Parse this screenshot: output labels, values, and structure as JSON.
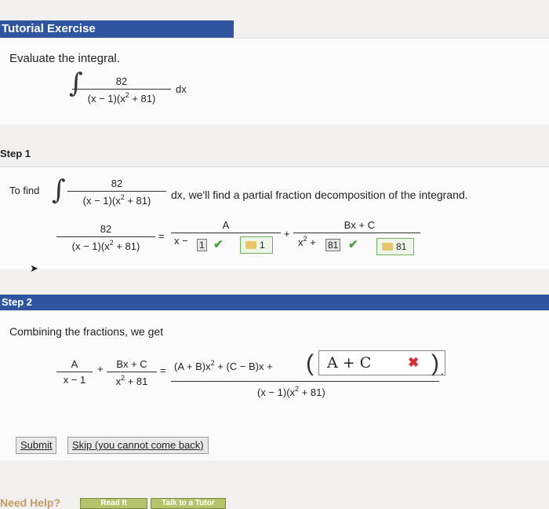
{
  "header": {
    "title": "Tutorial Exercise"
  },
  "prompt": "Evaluate the integral.",
  "integral": {
    "numerator": "82",
    "denominator_a": "(x − 1)(x",
    "exp": "2",
    "denominator_b": " + 81)",
    "dx": "dx"
  },
  "step1": {
    "title": "Step 1",
    "lead": "To find",
    "tail": "dx, we'll find a partial fraction decomposition of the integrand.",
    "lhs_num": "82",
    "lhs_den_a": "(x − 1)(x",
    "lhs_den_b": " + 81)",
    "eq": "=",
    "A": "A",
    "den1_prefix": "x −",
    "den1_box": "1",
    "plus": "+",
    "num2": "Bx + C",
    "den2_prefix": "x",
    "den2_plus": " +",
    "den2_box": "81",
    "key1_value": "1",
    "key2_value": "81"
  },
  "step2": {
    "title": "Step 2",
    "lead": "Combining the fractions, we get",
    "f1_num": "A",
    "f1_den": "x − 1",
    "plus": "+",
    "f2_num": "Bx + C",
    "f2_den_a": "x",
    "f2_den_b": " + 81",
    "eq": "=",
    "big_num_a": "(A + B)x",
    "big_num_b": " + (C − B)x +",
    "answer": "A + C",
    "big_den_a": "(x − 1)(x",
    "big_den_b": " + 81)",
    "period": "."
  },
  "buttons": {
    "submit": "Submit",
    "skip": "Skip (you cannot come back)"
  },
  "footer": {
    "need_help": "Need Help?",
    "read_it": "Read It",
    "talk": "Talk to a Tutor"
  },
  "colors": {
    "header": "#2f55a0",
    "check": "#4aa040",
    "cross": "#d23030"
  }
}
